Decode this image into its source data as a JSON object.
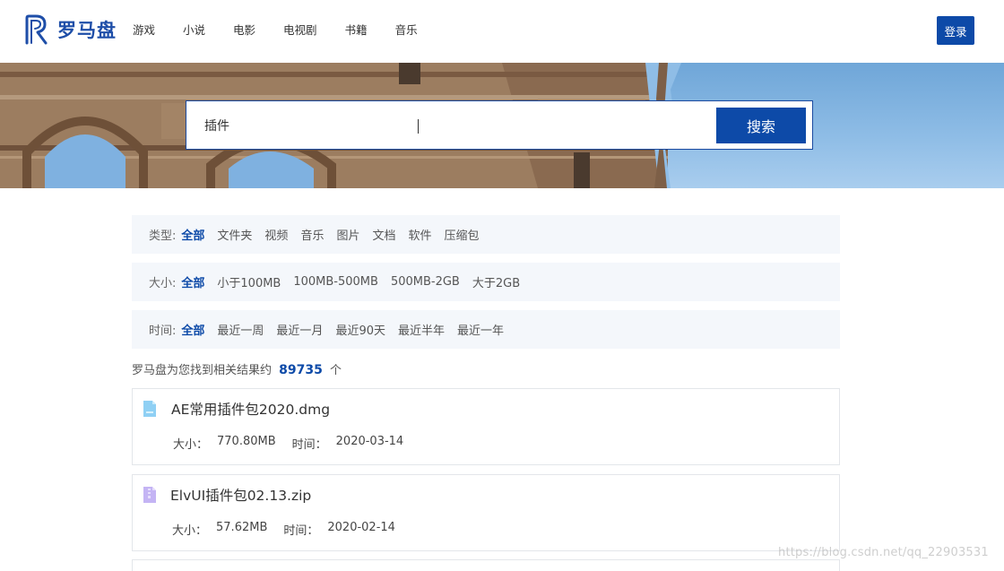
{
  "brand": {
    "name": "罗马盘"
  },
  "nav": [
    "游戏",
    "小说",
    "电影",
    "电视剧",
    "书籍",
    "音乐"
  ],
  "login_label": "登录",
  "search": {
    "value": "插件",
    "button_label": "搜索"
  },
  "filters": {
    "type": {
      "label": "类型:",
      "options": [
        "全部",
        "文件夹",
        "视频",
        "音乐",
        "图片",
        "文档",
        "软件",
        "压缩包"
      ],
      "active": "全部"
    },
    "size": {
      "label": "大小:",
      "options": [
        "全部",
        "小于100MB",
        "100MB-500MB",
        "500MB-2GB",
        "大于2GB"
      ],
      "active": "全部"
    },
    "time": {
      "label": "时间:",
      "options": [
        "全部",
        "最近一周",
        "最近一月",
        "最近90天",
        "最近半年",
        "最近一年"
      ],
      "active": "全部"
    }
  },
  "result_summary": {
    "prefix": "罗马盘为您找到相关结果约",
    "count": "89735",
    "suffix": "个"
  },
  "results": [
    {
      "title": "AE常用插件包2020.dmg",
      "size_label": "大小：",
      "size": "770.80MB",
      "time_label": "时间：",
      "time": "2020-03-14",
      "icon": "dmg-file-icon",
      "icon_color": "#7cc6f0"
    },
    {
      "title": "ElvUI插件包02.13.zip",
      "size_label": "大小：",
      "size": "57.62MB",
      "time_label": "时间：",
      "time": "2020-02-14",
      "icon": "zip-file-icon",
      "icon_color": "#b8a6f0"
    }
  ],
  "watermark": "https://blog.csdn.net/qq_22903531",
  "colors": {
    "accent": "#0d4aa8",
    "filter_bg": "#f4f7fb",
    "sky": "#8fbde6",
    "stone": "#9a7a5e"
  }
}
